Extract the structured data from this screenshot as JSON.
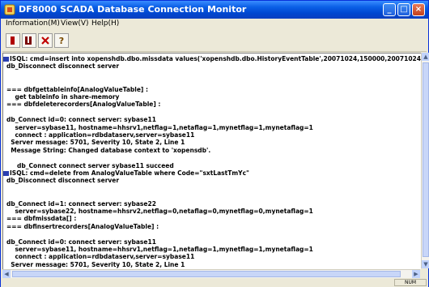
{
  "window": {
    "title": "DF8000 SCADA Database Connection Monitor"
  },
  "titlebar_buttons": {
    "minimize": "_",
    "maximize": "□",
    "close": "×"
  },
  "menu": [
    {
      "label": "Information(M)"
    },
    {
      "label": "View(V)"
    },
    {
      "label": "Help(H)"
    }
  ],
  "toolbar": [
    {
      "name": "stop-icon",
      "glyph": "■",
      "color": "#b00000"
    },
    {
      "name": "run-icon",
      "glyph": "II",
      "color": "#8a0000"
    },
    {
      "name": "delete-icon",
      "glyph": "✕",
      "color": "#c00000"
    },
    {
      "name": "help-icon",
      "glyph": "?",
      "color": "#7a4a00"
    }
  ],
  "log_lines": [
    "ISQL: cmd=insert into xopenshdb.dbo.missdata values('xopenshdb.dbo.HistoryEventTable',20071024,150000,20071024,15",
    "db_Disconnect disconnect server",
    "",
    "",
    "=== dbfgettableinfo[AnalogValueTable] :",
    "    get tableinfo in share-memory",
    "=== dbfdeleterecorders[AnalogValueTable] :",
    "",
    "db_Connect id=0: connect server: sybase11",
    "    server=sybase11, hostname=hhsrv1,netflag=1,netaflag=1,mynetflag=1,mynetaflag=1",
    "    connect : application=rdbdataserv,server=sybase11",
    "  Server message: 5701, Severity 10, State 2, Line 1",
    "  Message String: Changed database context to 'xopensdb'.",
    "",
    "     db_Connect connect server sybase11 succeed",
    "ISQL: cmd=delete from AnalogValueTable where Code=\"sxtLastTmYc\"",
    "db_Disconnect disconnect server",
    "",
    "",
    "db_Connect id=1: connect server: sybase22",
    "    server=sybase22, hostname=hhsrv2,netflag=0,netaflag=0,mynetflag=0,mynetaflag=1",
    "=== dbfmissdata[] :",
    "=== dbfinsertrecorders[AnalogValueTable] :",
    "",
    "db_Connect id=0: connect server: sybase11",
    "    server=sybase11, hostname=hhsrv1,netflag=1,netaflag=1,mynetflag=1,mynetaflag=1",
    "    connect : application=rdbdataserv,server=sybase11",
    "  Server message: 5701, Severity 10, State 2, Line 1"
  ],
  "status": {
    "num": "NUM"
  }
}
